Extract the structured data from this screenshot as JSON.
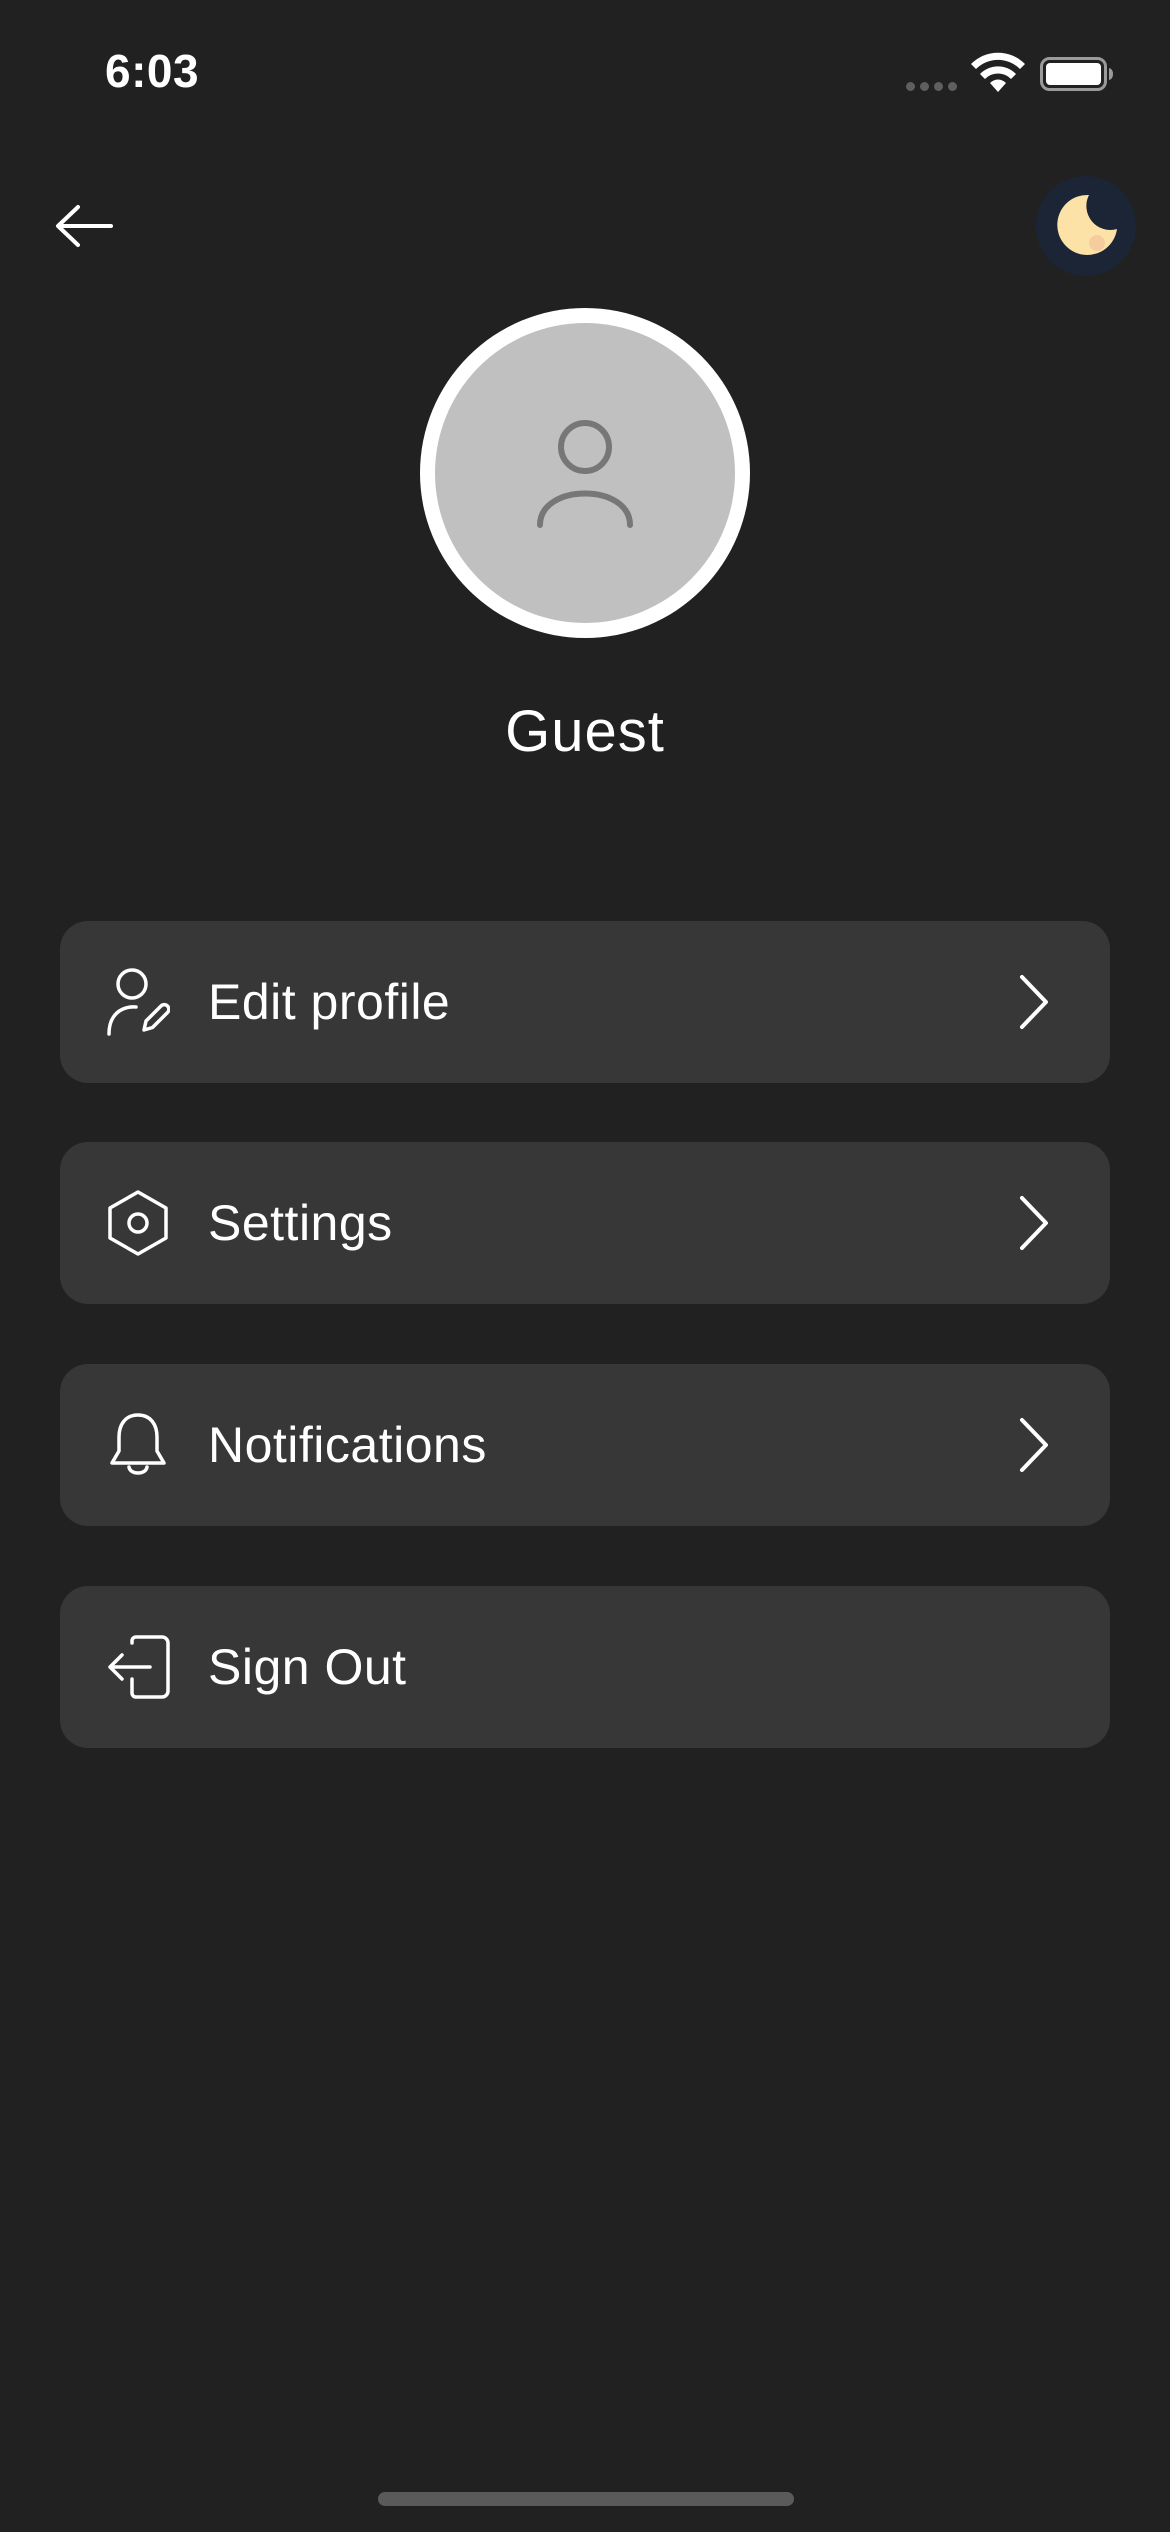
{
  "status_bar": {
    "time": "6:03",
    "wifi_icon": "wifi-icon",
    "battery_icon": "battery-icon"
  },
  "nav": {
    "back_icon": "arrow-left-icon",
    "theme_icon": "moon-icon"
  },
  "profile": {
    "avatar_icon": "user-icon",
    "name": "Guest"
  },
  "menu": {
    "items": [
      {
        "label": "Edit profile",
        "icon": "user-edit-icon",
        "has_chevron": true
      },
      {
        "label": "Settings",
        "icon": "hexagon-settings-icon",
        "has_chevron": true
      },
      {
        "label": "Notifications",
        "icon": "bell-icon",
        "has_chevron": true
      },
      {
        "label": "Sign Out",
        "icon": "sign-out-icon",
        "has_chevron": false
      }
    ]
  },
  "colors": {
    "background": "#212121",
    "card": "#373737",
    "text": "#ffffff",
    "avatar_bg": "#c0c0c0",
    "moon": "#fde2a8",
    "theme_button": "#1b2536"
  }
}
